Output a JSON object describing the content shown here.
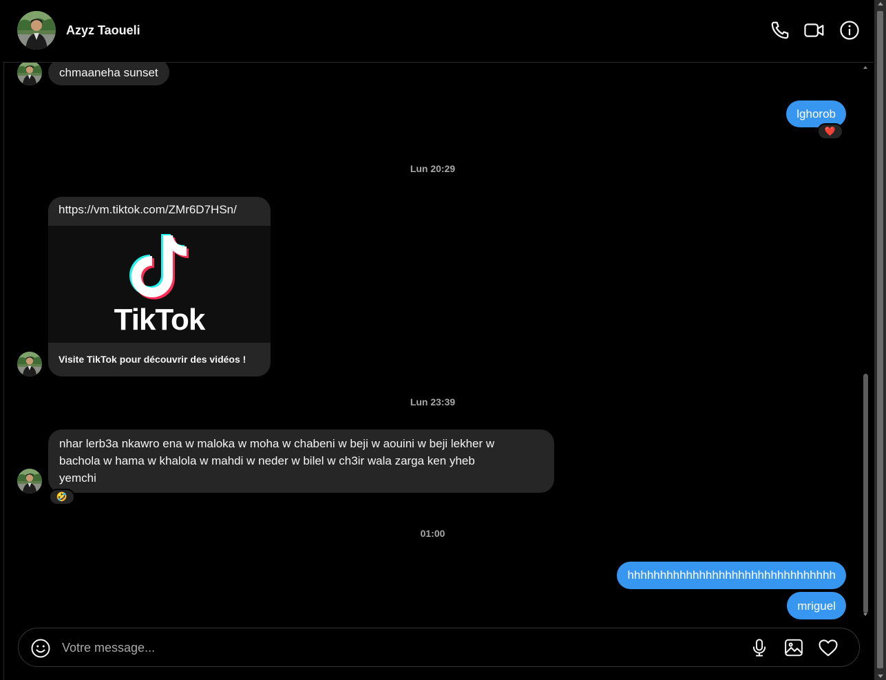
{
  "contact": {
    "name": "Azyz Taoueli",
    "avatar_icon": "profile-photo"
  },
  "header_actions": [
    {
      "name": "phone-call",
      "icon": "phone-icon"
    },
    {
      "name": "video-call",
      "icon": "video-camera-icon"
    },
    {
      "name": "conversation-info",
      "icon": "info-icon"
    }
  ],
  "messages": {
    "m1": {
      "text": "chmaaneha sunset",
      "from": "contact"
    },
    "m2": {
      "text": "lghorob",
      "from": "me",
      "reaction": "❤️"
    },
    "t1": {
      "text": "Lun 20:29"
    },
    "m3": {
      "from": "contact",
      "url": "https://vm.tiktok.com/ZMr6D7HSn/",
      "preview_wordmark": "TikTok",
      "preview_description": "Visite TikTok pour découvrir des vidéos !"
    },
    "t2": {
      "text": "Lun 23:39"
    },
    "m4": {
      "from": "contact",
      "lines": [
        "nhar lerb3a nkawro ena w maloka  w moha w chabeni w beji w aouini w beji lekher w",
        "bachola w hama w khalola w mahdi w neder w bilel w ch3ir wala zarga ken yheb",
        "yemchi"
      ],
      "reaction": "🤣"
    },
    "t3": {
      "text": "01:00"
    },
    "m5": {
      "text": "hhhhhhhhhhhhhhhhhhhhhhhhhhhhhhhh",
      "from": "me"
    },
    "m6": {
      "text": "mriguel",
      "from": "me"
    }
  },
  "composer": {
    "placeholder": "Votre message...",
    "value": "",
    "buttons": [
      "emoji-icon",
      "microphone-icon",
      "image-icon",
      "heart-icon"
    ]
  },
  "colors": {
    "background": "#000000",
    "incoming_bubble": "#262626",
    "outgoing_bubble": "#3797f0",
    "timestamp": "#a8a8a8"
  }
}
